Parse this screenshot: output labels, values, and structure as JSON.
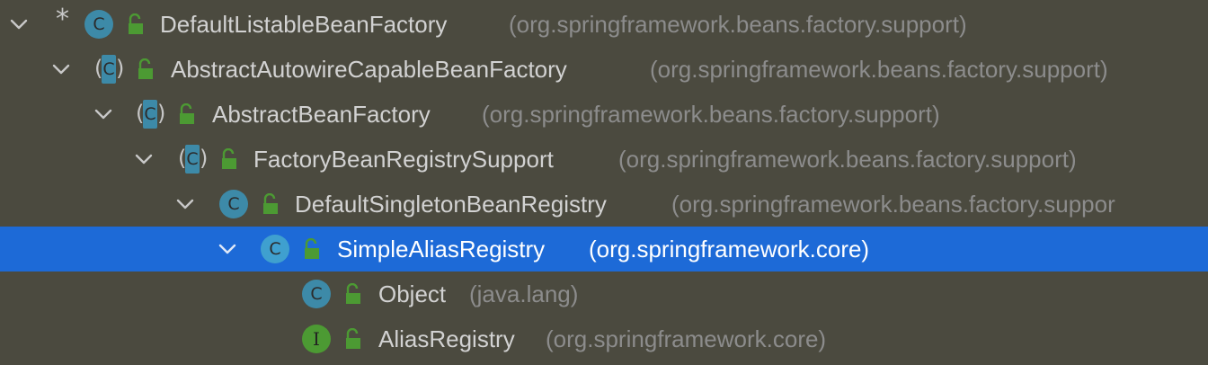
{
  "hierarchy": {
    "rows": [
      {
        "marker": "*",
        "kind": "class",
        "name": "DefaultListableBeanFactory",
        "package": "(org.springframework.beans.factory.support)",
        "expanded": true
      },
      {
        "kind": "abstract-class",
        "name": "AbstractAutowireCapableBeanFactory",
        "package": "(org.springframework.beans.factory.support)",
        "expanded": true
      },
      {
        "kind": "abstract-class",
        "name": "AbstractBeanFactory",
        "package": "(org.springframework.beans.factory.support)",
        "expanded": true
      },
      {
        "kind": "abstract-class",
        "name": "FactoryBeanRegistrySupport",
        "package": "(org.springframework.beans.factory.support)",
        "expanded": true
      },
      {
        "kind": "class",
        "name": "DefaultSingletonBeanRegistry",
        "package": "(org.springframework.beans.factory.suppor",
        "expanded": true
      },
      {
        "kind": "class",
        "name": "SimpleAliasRegistry",
        "package": "(org.springframework.core)",
        "expanded": true,
        "selected": true
      },
      {
        "kind": "class",
        "name": "Object",
        "package": "(java.lang)"
      },
      {
        "kind": "interface",
        "name": "AliasRegistry",
        "package": "(org.springframework.core)"
      }
    ],
    "icon_letters": {
      "class": "C",
      "interface": "I"
    }
  },
  "colors": {
    "background": "#4b4a3f",
    "selection": "#1d6ad7",
    "class_icon": "#3d8aa8",
    "interface_icon": "#4c9a33",
    "lock_icon": "#4c9a33",
    "name_text": "#d2d2d2",
    "package_text": "#8c8c8c"
  }
}
